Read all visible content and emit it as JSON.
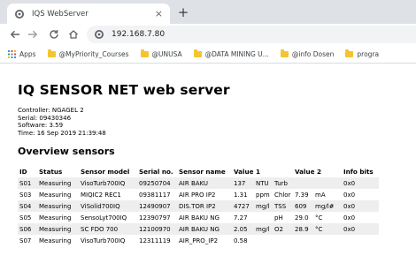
{
  "browser": {
    "tab_title": "IQS WebServer",
    "tab_close_glyph": "×",
    "new_tab_glyph": "+",
    "url": "192.168.7.80",
    "icons": [
      "back-arrow-icon",
      "forward-arrow-icon",
      "reload-icon",
      "home-icon",
      "site-info-icon"
    ]
  },
  "bookmarks": [
    {
      "label": "Apps",
      "icon": "apps-grid-icon"
    },
    {
      "label": "@MyPriority_Courses",
      "icon": "folder-icon"
    },
    {
      "label": "@UNUSA",
      "icon": "folder-icon"
    },
    {
      "label": "@DATA MINING U...",
      "icon": "folder-icon"
    },
    {
      "label": "@info Dosen",
      "icon": "folder-icon"
    },
    {
      "label": "progra",
      "icon": "folder-icon"
    }
  ],
  "page": {
    "title": "IQ SENSOR NET web server",
    "info": [
      "Controller: NGAGEL 2",
      "Serial: 09430346",
      "Software: 3.59",
      "Time: 16 Sep 2019 21:39:48"
    ],
    "section_title": "Overview sensors"
  },
  "table": {
    "headers": [
      "ID",
      "Status",
      "Sensor model",
      "Serial no.",
      "Sensor name",
      "Value 1",
      "",
      "",
      "Value 2",
      "",
      "Info bits"
    ],
    "rows": [
      [
        "S01",
        "Measuring",
        "VisoTurb700IQ",
        "09250704",
        "AIR BAKU",
        "137",
        "NTU",
        "Turb",
        "",
        "",
        "0x0"
      ],
      [
        "S03",
        "Measuring",
        "MIQIC2 REC1",
        "09381117",
        "AIR PRO IP2",
        "1.31",
        "ppm",
        "Chlor",
        "7.39",
        "mA",
        "0x0"
      ],
      [
        "S04",
        "Measuring",
        "ViSolid700IQ",
        "12490907",
        "DIS.TOR IP2",
        "4727",
        "mg/l",
        "TSS",
        "609",
        "mg/l#",
        "0x0"
      ],
      [
        "S05",
        "Measuring",
        "SensoLyt700IQ",
        "12390797",
        "AIR BAKU NG",
        "7.27",
        "",
        "pH",
        "29.0",
        "°C",
        "0x0"
      ],
      [
        "S06",
        "Measuring",
        "SC FDO 700",
        "12100970",
        "AIR BAKU NG",
        "2.05",
        "mg/l",
        "O2",
        "28.9",
        "°C",
        "0x0"
      ],
      [
        "S07",
        "Measuring",
        "VisoTurb700IQ",
        "12311119",
        "AIR_PRO_IP2",
        "0.58",
        "",
        "",
        "",
        "",
        ""
      ]
    ]
  },
  "colors": {
    "tabstrip": "#dee1e6",
    "omnibox": "#f1f3f4",
    "row_stripe": "#eeeeee",
    "folder": "#f4c430"
  }
}
